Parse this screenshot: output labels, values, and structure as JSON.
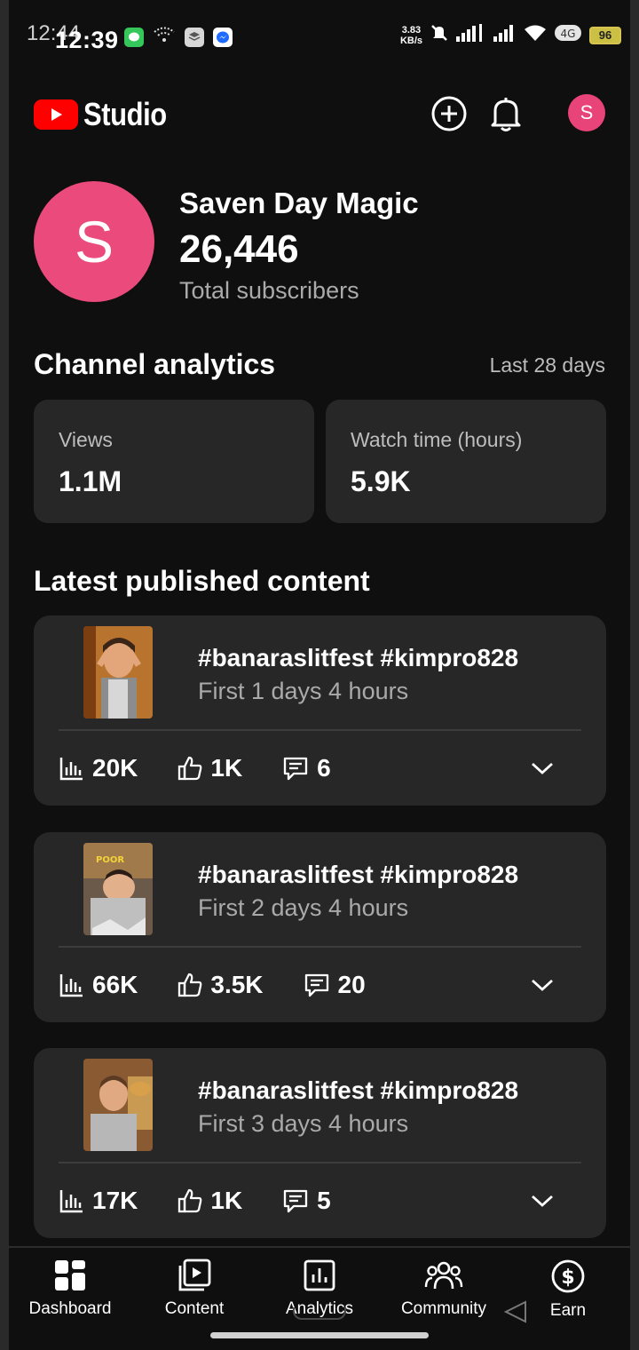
{
  "status_bar": {
    "time_ghost": "12:44",
    "time": "12:39",
    "net_speed_value": "3.83",
    "net_speed_unit": "KB/s",
    "battery": "96"
  },
  "header": {
    "logo_text": "Studio",
    "avatar_letter": "S",
    "brand_color": "#ff0000"
  },
  "channel": {
    "avatar_letter": "S",
    "name": "Saven Day Magic",
    "subscribers": "26,446",
    "subscribers_label": "Total subscribers",
    "avatar_color": "#ea4b7c"
  },
  "analytics": {
    "title": "Channel analytics",
    "range": "Last 28 days",
    "views_label": "Views",
    "views_value": "1.1M",
    "watch_label": "Watch time (hours)",
    "watch_value": "5.9K"
  },
  "latest": {
    "title": "Latest published content",
    "items": [
      {
        "title": "#banaraslitfest #kimpro828",
        "period": "First 1 days 4 hours",
        "views": "20K",
        "likes": "1K",
        "comments": "6"
      },
      {
        "title": "#banaraslitfest #kimpro828",
        "period": "First 2 days 4 hours",
        "views": "66K",
        "likes": "3.5K",
        "comments": "20",
        "thumb_caption": "POOR"
      },
      {
        "title": "#banaraslitfest #kimpro828",
        "period": "First 3 days 4 hours",
        "views": "17K",
        "likes": "1K",
        "comments": "5"
      }
    ]
  },
  "nav": {
    "dashboard": "Dashboard",
    "content": "Content",
    "analytics": "Analytics",
    "community": "Community",
    "earn": "Earn"
  }
}
